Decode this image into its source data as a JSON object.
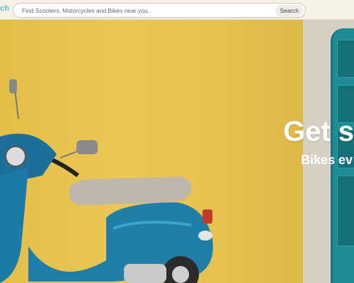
{
  "header": {
    "brand_fragment": "ch",
    "search": {
      "placeholder": "Find Scooters, Motorcycles and Bikes near you..",
      "value": "",
      "button_label": "Search"
    }
  },
  "hero": {
    "headline": "Get s",
    "subheadline": "Bikes ev"
  },
  "colors": {
    "brand": "#54c3d6",
    "wall": "#e9c551",
    "door": "#1e8c95",
    "scooter": "#1f7fa8"
  }
}
